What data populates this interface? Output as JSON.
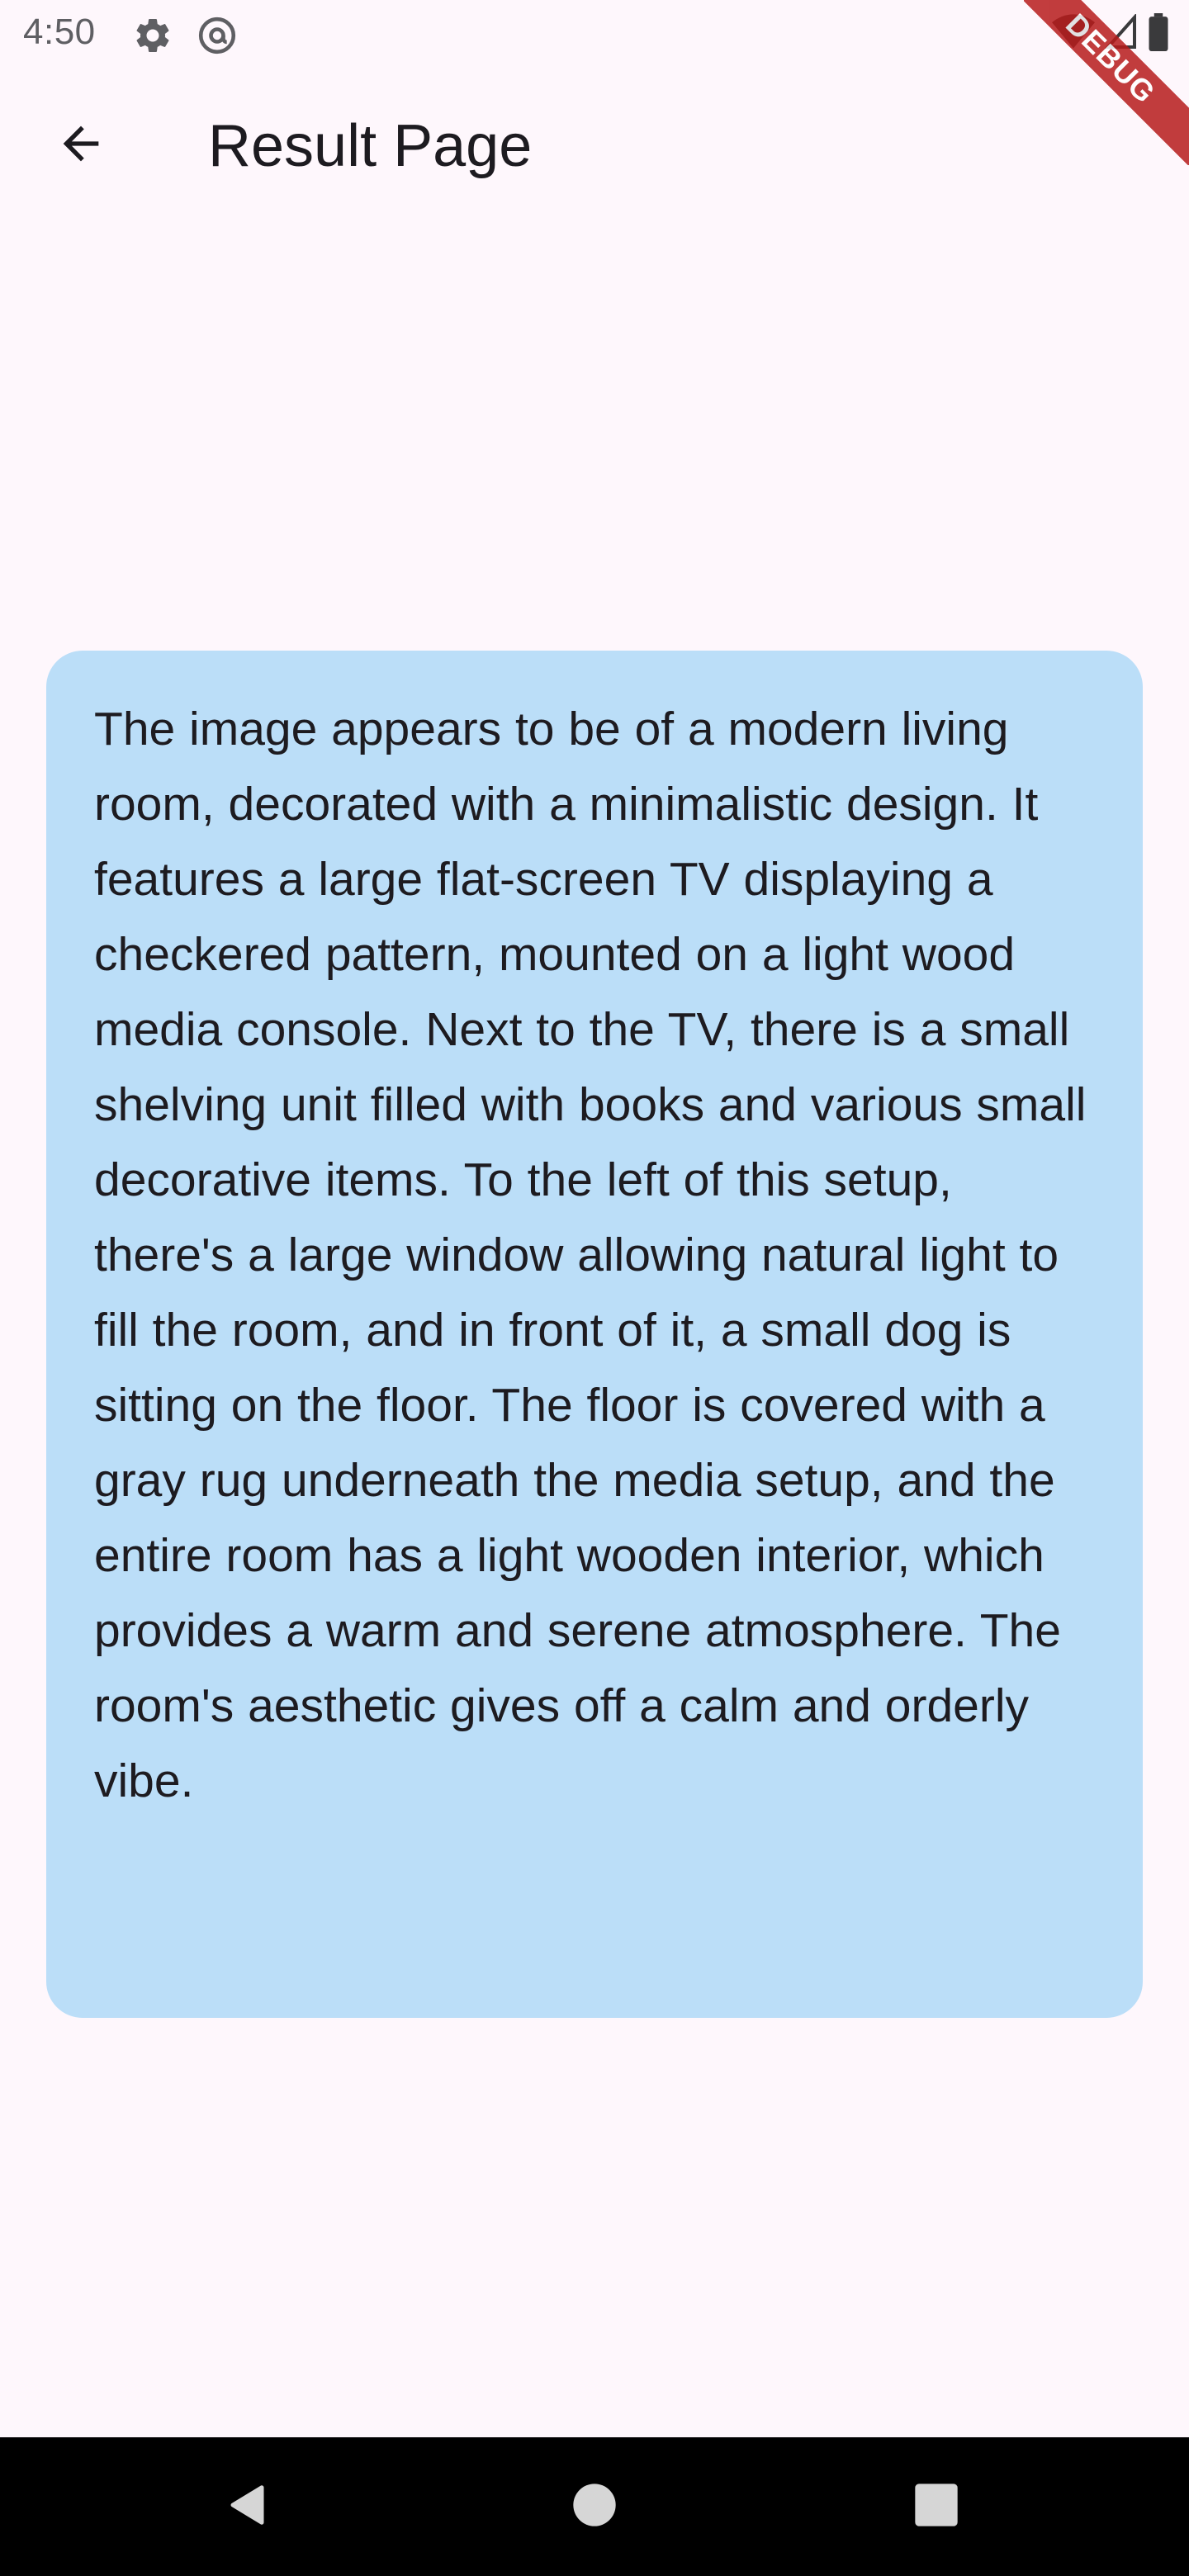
{
  "status_bar": {
    "time": "4:50",
    "left_icons": [
      "settings-icon",
      "at-sign-icon"
    ],
    "right_icons": [
      "wifi-icon",
      "signal-icon",
      "battery-icon"
    ]
  },
  "debug_banner": {
    "label": "DEBUG"
  },
  "app_bar": {
    "back_icon": "arrow-back-icon",
    "title": "Result Page"
  },
  "result": {
    "text": "The image appears to be of a modern living room, decorated with a minimalistic design. It features a large flat-screen TV displaying a checkered pattern, mounted on a light wood media console. Next to the TV, there is a small shelving unit filled with books and various small decorative items. To the left of this setup, there's a large window allowing natural light to fill the room, and in front of it, a small dog is sitting on the floor. The floor is covered with a gray rug underneath the media setup, and the entire room has a light wooden interior, which provides a warm and serene atmosphere. The room's aesthetic gives off a calm and orderly vibe."
  },
  "nav_bar": {
    "buttons": [
      "nav-back-icon",
      "nav-home-icon",
      "nav-recents-icon"
    ]
  },
  "colors": {
    "background": "#FEF7FC",
    "card": "#BBDEF8",
    "text": "#1D1B20",
    "nav_bar": "#000000",
    "debug_ribbon": "#B71C1C"
  }
}
